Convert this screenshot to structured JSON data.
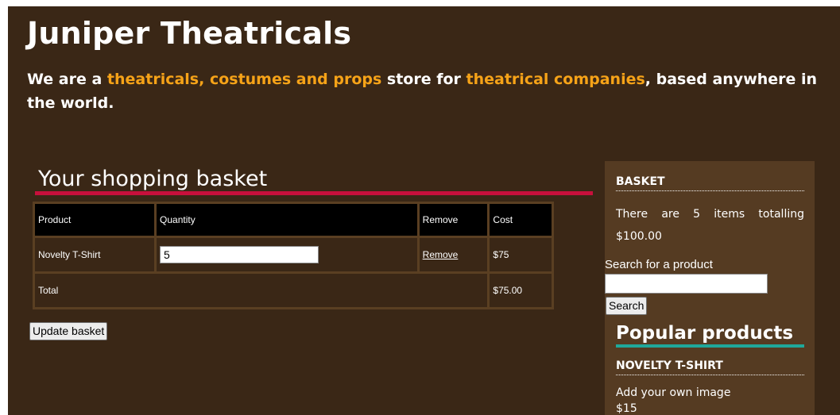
{
  "site": {
    "title": "Juniper Theatricals",
    "tagline": {
      "part1": "We are a ",
      "highlight1": "theatricals, costumes and props",
      "part2": " store for ",
      "highlight2": "theatrical companies",
      "part3": ", based anywhere in the world."
    }
  },
  "basket_page": {
    "heading": "Your shopping basket",
    "columns": [
      "Product",
      "Quantity",
      "Remove",
      "Cost"
    ],
    "items": [
      {
        "product": "Novelty T-Shirt",
        "quantity": "5",
        "remove": "Remove",
        "cost": "$75"
      }
    ],
    "total_label": "Total",
    "total_value": "$75.00",
    "update_button": "Update basket"
  },
  "sidebar": {
    "basket_heading": "BASKET",
    "basket_summary": "There are 5 items totalling $100.00",
    "search_label": "Search for a product",
    "search_value": "",
    "search_button": "Search",
    "popular_heading": "Popular products",
    "product_name": "NOVELTY T-SHIRT",
    "product_desc": "Add your own image",
    "product_price": "$15"
  },
  "colors": {
    "background": "#3a2716",
    "sidebar": "#553b22",
    "highlight": "#f6a318",
    "heading_underline": "#c8103c",
    "popular_underline": "#20a89a"
  }
}
